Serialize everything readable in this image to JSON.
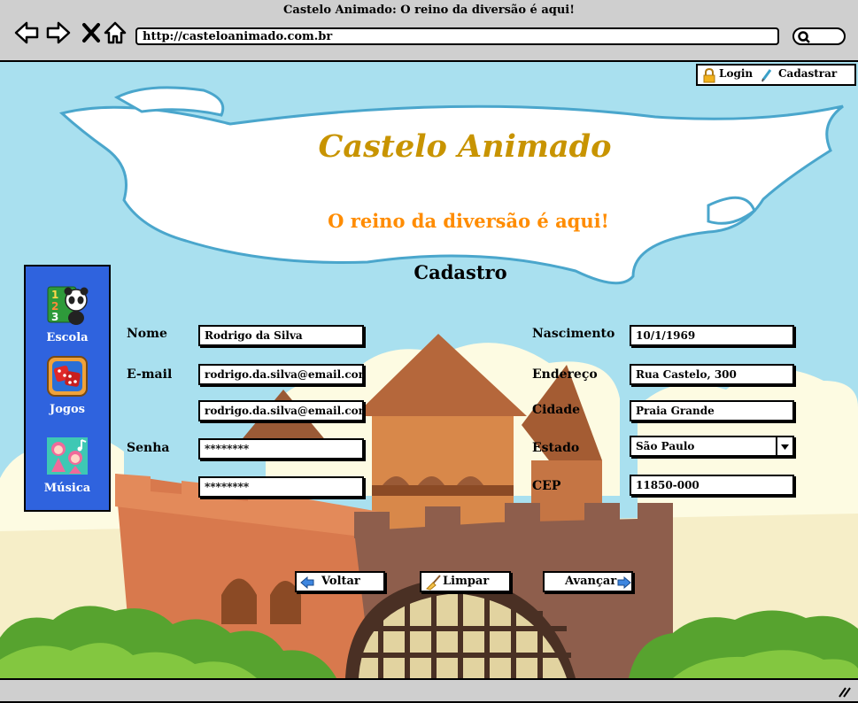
{
  "browser": {
    "window_title": "Castelo Animado: O reino da diversão é aqui!",
    "url": "http://casteloanimado.com.br",
    "icons": [
      "back-icon",
      "forward-icon",
      "close-icon",
      "home-icon",
      "search-icon"
    ]
  },
  "auth": {
    "login_label": "Login",
    "register_label": "Cadastrar"
  },
  "site": {
    "title": "Castelo Animado",
    "tagline": "O reino da diversão é aqui!"
  },
  "page": {
    "title": "Cadastro"
  },
  "sidebar": {
    "items": [
      {
        "label": "Escola",
        "icon": "panda-numbers-icon"
      },
      {
        "label": "Jogos",
        "icon": "dice-icon"
      },
      {
        "label": "Música",
        "icon": "music-kids-icon"
      }
    ]
  },
  "form": {
    "name": {
      "label": "Nome",
      "value": "Rodrigo da Silva"
    },
    "email": {
      "label": "E-mail",
      "value": "rodrigo.da.silva@email.com",
      "confirm_value": "rodrigo.da.silva@email.com"
    },
    "password": {
      "label": "Senha",
      "value": "********",
      "confirm_value": "********"
    },
    "birth": {
      "label": "Nascimento",
      "value": "10/1/1969"
    },
    "address": {
      "label": "Endereço",
      "value": "Rua Castelo, 300"
    },
    "city": {
      "label": "Cidade",
      "value": "Praia Grande"
    },
    "state": {
      "label": "Estado",
      "value": "São Paulo"
    },
    "cep": {
      "label": "CEP",
      "value": "11850-000"
    }
  },
  "buttons": {
    "back": "Voltar",
    "clear": "Limpar",
    "next": "Avançar"
  },
  "colors": {
    "sky": "#a9e0ef",
    "title": "#c89400",
    "tagline": "#ff8c00",
    "sidebar": "#2f63de",
    "chrome": "#cfcfcf"
  }
}
